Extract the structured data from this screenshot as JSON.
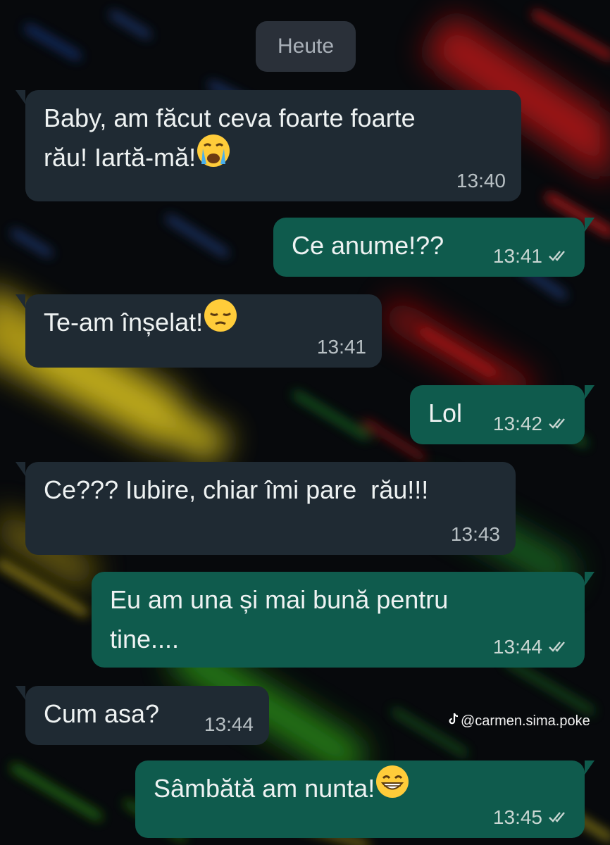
{
  "date_chip": "Heute",
  "messages": [
    {
      "dir": "in",
      "lines": [
        "Baby, am făcut ceva foarte foarte",
        "rău! Iartă-mă!"
      ],
      "emoji": "crying-face-icon",
      "time": "13:40"
    },
    {
      "dir": "out",
      "text": "Ce anume!??",
      "time": "13:41",
      "status": "read"
    },
    {
      "dir": "in",
      "text": "Te-am înșelat!",
      "emoji": "pensive-face-icon",
      "time": "13:41"
    },
    {
      "dir": "out",
      "text": "Lol",
      "time": "13:42",
      "status": "read"
    },
    {
      "dir": "in",
      "text": "Ce??? Iubire, chiar îmi pare  rău!!!",
      "time": "13:43"
    },
    {
      "dir": "out",
      "lines": [
        "Eu am una și mai bună pentru",
        "tine...."
      ],
      "time": "13:44",
      "status": "read"
    },
    {
      "dir": "in",
      "text": "Cum asa?",
      "time": "13:44"
    },
    {
      "dir": "out",
      "text": "Sâmbătă am nunta!",
      "emoji": "grinning-face-icon",
      "time": "13:45",
      "status": "read"
    }
  ],
  "watermark": "@carmen.sima.poke",
  "colors": {
    "incoming_bubble": "#1f2a33",
    "outgoing_bubble": "#0f5b4d",
    "read_ticks": "#c9d6d2"
  }
}
